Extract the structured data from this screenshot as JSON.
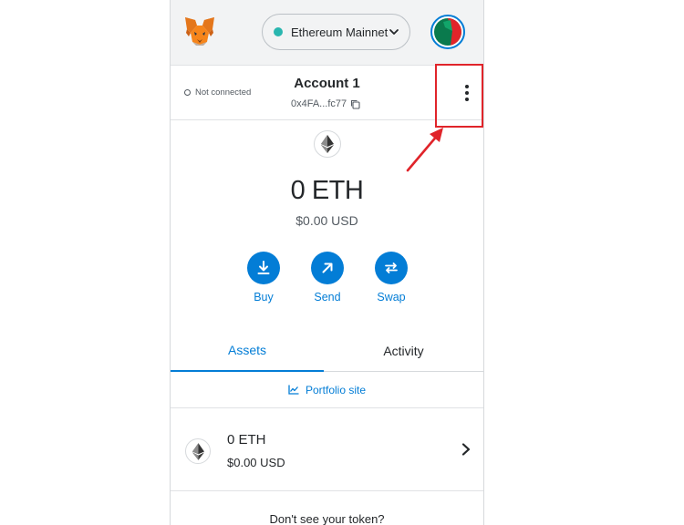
{
  "header": {
    "network_label": "Ethereum Mainnet",
    "icons": {
      "logo": "metamask-fox-icon",
      "network_dropdown": "chevron-down-icon",
      "account_avatar": "identicon"
    }
  },
  "account": {
    "connection_status": "Not connected",
    "name": "Account 1",
    "address": "0x4FA...fc77",
    "icons": {
      "copy": "copy-icon",
      "menu": "kebab-menu-icon"
    }
  },
  "balance": {
    "amount": "0 ETH",
    "usd": "$0.00 USD"
  },
  "actions": [
    {
      "label": "Buy",
      "icon": "download-icon"
    },
    {
      "label": "Send",
      "icon": "arrow-up-right-icon"
    },
    {
      "label": "Swap",
      "icon": "swap-icon"
    }
  ],
  "tabs": [
    {
      "label": "Assets",
      "active": true
    },
    {
      "label": "Activity",
      "active": false
    }
  ],
  "portfolio_link": "Portfolio site",
  "assets": [
    {
      "amount": "0 ETH",
      "usd": "$0.00 USD",
      "icon": "ethereum-icon"
    }
  ],
  "footer_prompt": "Don't see your token?",
  "colors": {
    "accent": "#037dd6",
    "network_dot": "#29b6af",
    "annotation": "#e0242a",
    "header_bg": "#f2f3f4"
  }
}
